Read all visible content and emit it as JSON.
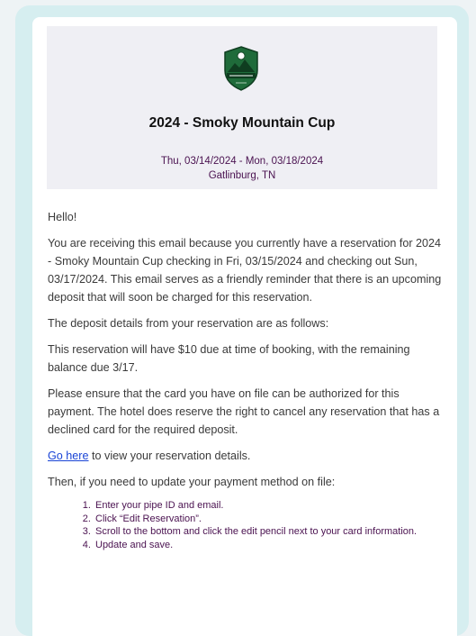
{
  "header": {
    "logo_alt": "Smoky Mountain Cup logo",
    "event_title": "2024 - Smoky Mountain Cup",
    "dates": "Thu, 03/14/2024 - Mon, 03/18/2024",
    "location": "Gatlinburg, TN"
  },
  "email": {
    "greeting": "Hello!",
    "para1": "You are receiving this email because you currently have a reservation for 2024 - Smoky Mountain Cup checking in Fri, 03/15/2024 and checking out Sun, 03/17/2024. This email serves as a friendly reminder that there is an upcoming deposit that will soon be charged for this reservation.",
    "para2": "The deposit details from your reservation are as follows:",
    "para3": "This reservation will have $10 due at time of booking, with the remaining balance due 3/17.",
    "para4": "Please ensure that the card you have on file can be authorized for this payment. The hotel does reserve the right to cancel any reservation that has a declined card for the required deposit.",
    "link_text": "Go here",
    "link_suffix": " to view your reservation details.",
    "para6": "Then, if you need to update your payment method on file:",
    "steps": [
      "Enter your pipe ID and email.",
      "Click “Edit Reservation”.",
      "Scroll to the bottom and click the edit pencil next to your card information.",
      "Update and save."
    ]
  },
  "colors": {
    "page_bg": "#eef3f5",
    "frame_bg": "#d6eef0",
    "header_bg": "#efeff4",
    "accent_purple": "#4a1250",
    "link_blue": "#1a44d6"
  }
}
